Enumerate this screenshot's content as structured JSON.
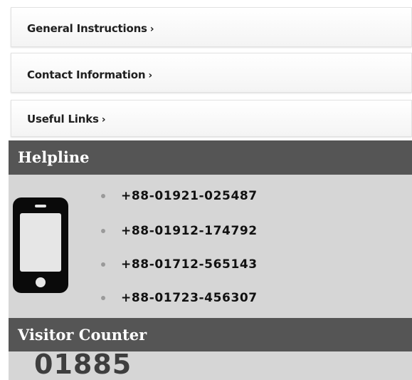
{
  "links": [
    {
      "label": "General Instructions",
      "chevron": "›"
    },
    {
      "label": "Contact Information",
      "chevron": "›"
    },
    {
      "label": "Useful Links",
      "chevron": "›"
    }
  ],
  "helpline": {
    "title": "Helpline",
    "icon": "mobile-phone-icon",
    "phones": [
      "+88-01921-025487",
      "+88-01912-174792",
      "+88-01712-565143",
      "+88-01723-456307"
    ]
  },
  "visitor_counter": {
    "title": "Visitor Counter",
    "value": "01885"
  },
  "colors": {
    "header_bg": "#555555",
    "section_bg": "#d6d6d6",
    "header_text": "#ffffff"
  }
}
